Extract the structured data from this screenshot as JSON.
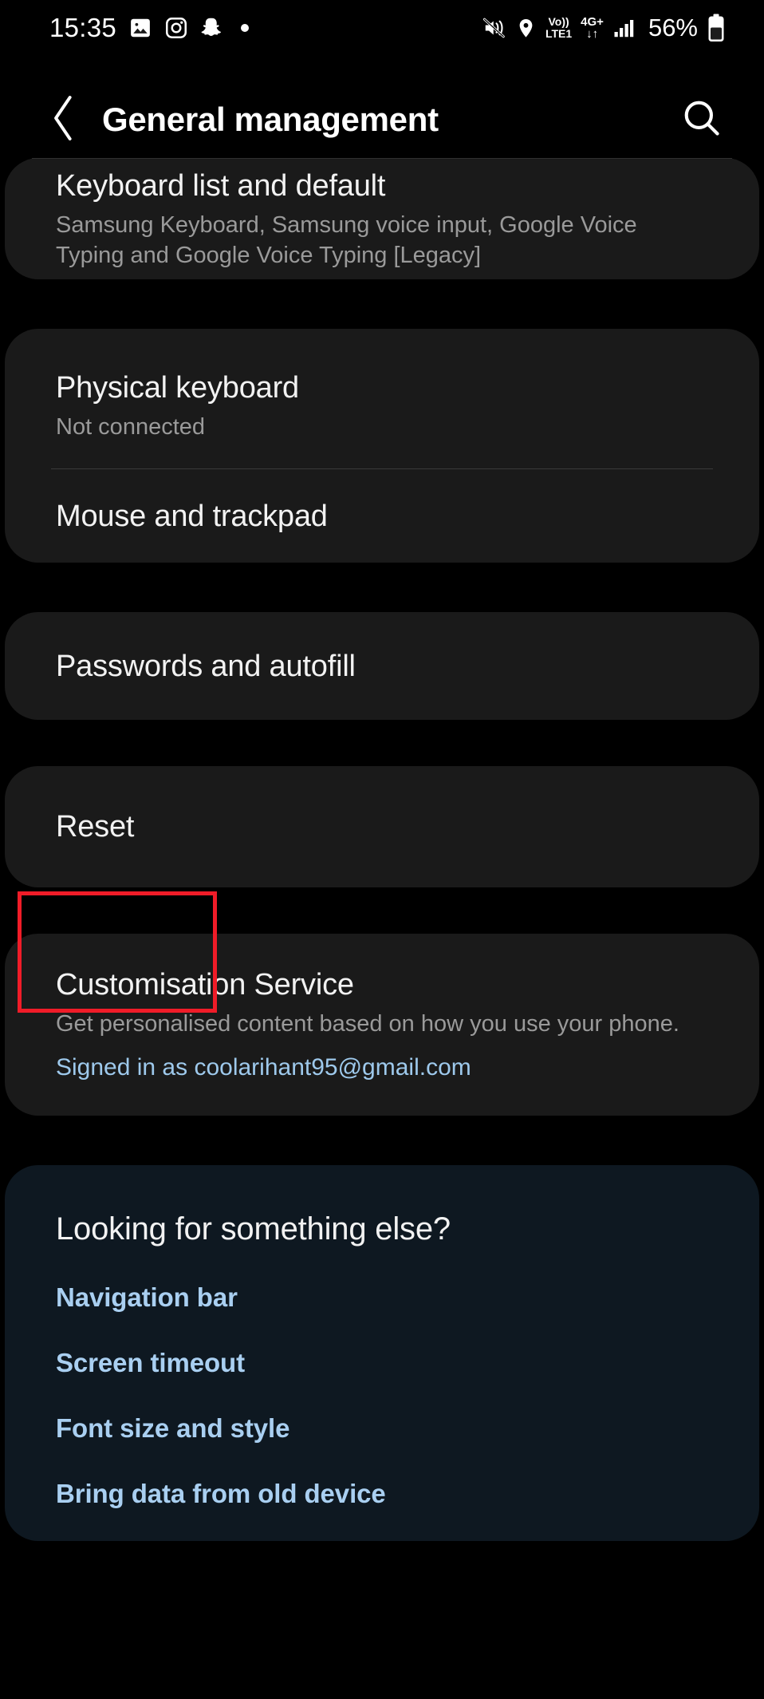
{
  "statusbar": {
    "time": "15:35",
    "left_icons": [
      "photos-icon",
      "instagram-icon",
      "snapchat-icon",
      "dot-indicator-icon"
    ],
    "mute_icon": "mute-vibrate-icon",
    "location_icon": "location-pin-icon",
    "volte_line1": "Vo))",
    "volte_line2": "LTE1",
    "network_line1": "4G+",
    "network_line2": "↓↑",
    "signal_icon": "signal-bars-icon",
    "battery_percent": "56%",
    "battery_icon": "battery-icon"
  },
  "header": {
    "back_icon": "back-chevron-icon",
    "title": "General management",
    "search_icon": "search-icon"
  },
  "sections": {
    "keyboard": {
      "title": "Keyboard list and default",
      "subtitle": "Samsung Keyboard, Samsung voice input, Google Voice Typing and Google Voice Typing [Legacy]"
    },
    "physical_keyboard": {
      "title": "Physical keyboard",
      "subtitle": "Not connected"
    },
    "mouse": {
      "title": "Mouse and trackpad"
    },
    "passwords": {
      "title": "Passwords and autofill"
    },
    "reset": {
      "title": "Reset"
    },
    "customisation": {
      "title": "Customisation Service",
      "subtitle": "Get personalised content based on how you use your phone.",
      "signed_in": "Signed in as coolarihant95@gmail.com"
    },
    "suggestions": {
      "title": "Looking for something else?",
      "links": [
        "Navigation bar",
        "Screen timeout",
        "Font size and style",
        "Bring data from old device"
      ]
    }
  },
  "annotation": {
    "highlight_target": "Reset",
    "highlight_color": "#f01c28"
  },
  "colors": {
    "background": "#000000",
    "card": "#1a1a1a",
    "card_suggestions": "#0e1821",
    "text_primary": "#f2f2f2",
    "text_secondary": "#9a9a9a",
    "link_blue": "#9ec9ec",
    "highlight_red": "#f01c28"
  }
}
